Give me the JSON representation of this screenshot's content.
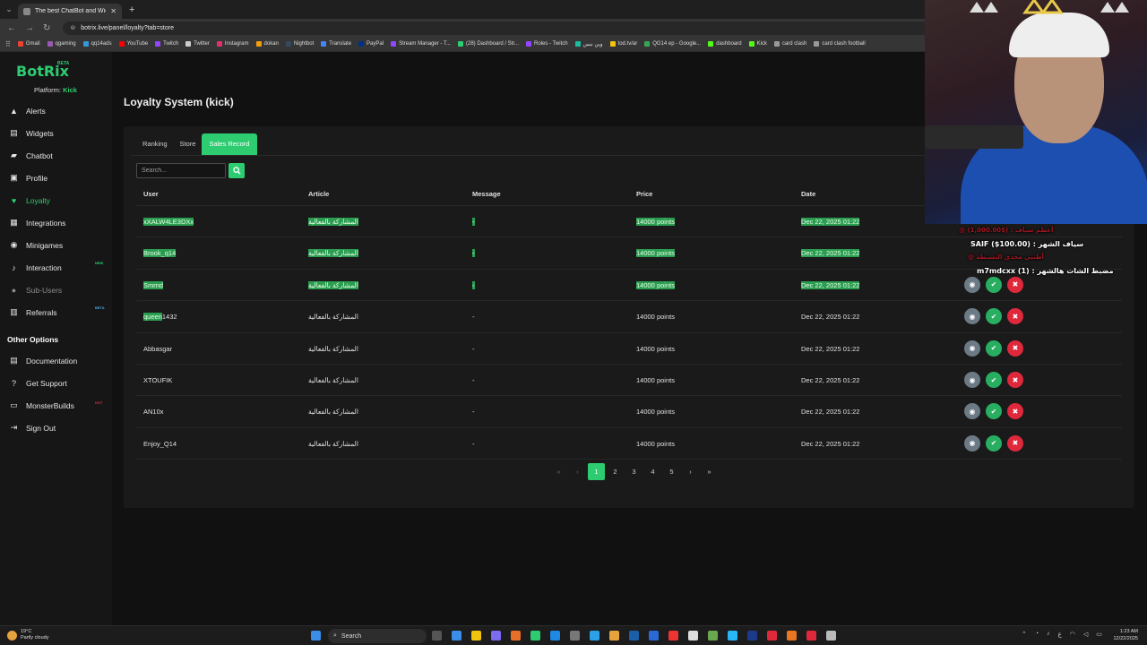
{
  "browser": {
    "tab_title": "The best ChatBot and Widgets",
    "url": "botrix.live/panel/loyalty?tab=store",
    "bookmarks": [
      {
        "label": "Gmail",
        "color": "#ea4335"
      },
      {
        "label": "qgaming",
        "color": "#9b59b6"
      },
      {
        "label": "qq14ads",
        "color": "#3498db"
      },
      {
        "label": "YouTube",
        "color": "#ff0000"
      },
      {
        "label": "Twitch",
        "color": "#9146ff"
      },
      {
        "label": "Twitter",
        "color": "#cccccc"
      },
      {
        "label": "Instagram",
        "color": "#e1306c"
      },
      {
        "label": "dokan",
        "color": "#f39c12"
      },
      {
        "label": "Nightbot",
        "color": "#34495e"
      },
      {
        "label": "Translate",
        "color": "#4285f4"
      },
      {
        "label": "PayPal",
        "color": "#003087"
      },
      {
        "label": "Stream Manager - T...",
        "color": "#9146ff"
      },
      {
        "label": "(28) Dashboard / Str...",
        "color": "#2ecc71"
      },
      {
        "label": "Roles - Twitch",
        "color": "#9146ff"
      },
      {
        "label": "وين نبس",
        "color": "#1abc9c"
      },
      {
        "label": "tod.tv/ar",
        "color": "#f1c40f"
      },
      {
        "label": "QG14 ep - Google...",
        "color": "#34a853"
      },
      {
        "label": "dashboard",
        "color": "#53fc18"
      },
      {
        "label": "Kick",
        "color": "#53fc18"
      },
      {
        "label": "card clash",
        "color": "#999999"
      },
      {
        "label": "card clash football",
        "color": "#999999"
      }
    ]
  },
  "sidebar": {
    "logo": "BotRix",
    "logo_badge": "BETA",
    "platform_label": "Platform:",
    "platform_value": "Kick",
    "items": [
      {
        "label": "Alerts",
        "icon": "▲",
        "state": ""
      },
      {
        "label": "Widgets",
        "icon": "▤",
        "state": ""
      },
      {
        "label": "Chatbot",
        "icon": "▰",
        "state": ""
      },
      {
        "label": "Profile",
        "icon": "▣",
        "state": ""
      },
      {
        "label": "Loyalty",
        "icon": "♥",
        "state": "active"
      },
      {
        "label": "Integrations",
        "icon": "▦",
        "state": ""
      },
      {
        "label": "Minigames",
        "icon": "◉",
        "state": ""
      },
      {
        "label": "Interaction",
        "icon": "♪",
        "state": ""
      },
      {
        "label": "Sub-Users",
        "icon": "●",
        "state": "disabled"
      },
      {
        "label": "Referrals",
        "icon": "▥",
        "state": ""
      }
    ],
    "interaction_tag": "NEW",
    "referrals_tag": "BETA",
    "other_options_title": "Other Options",
    "other_items": [
      {
        "label": "Documentation",
        "icon": "▤"
      },
      {
        "label": "Get Support",
        "icon": "?"
      },
      {
        "label": "MonsterBuilds",
        "icon": "▭"
      },
      {
        "label": "Sign Out",
        "icon": "⇥"
      }
    ],
    "monsterbuilds_tag": "HOT"
  },
  "main": {
    "title": "Loyalty System (kick)",
    "tabs": [
      "Ranking",
      "Store",
      "Sales Record"
    ],
    "active_tab": "Sales Record",
    "search_placeholder": "Search...",
    "columns": [
      "User",
      "Article",
      "Message",
      "Price",
      "Date"
    ],
    "rows": [
      {
        "user": "xXALW4LE3DXx",
        "article": "المشاركة بالفعالية",
        "message": "-",
        "price": "14000 points",
        "date": "Dec 22, 2025 01:22",
        "highlight": "full",
        "actions": false
      },
      {
        "user": "Brook_q14",
        "article": "المشاركة بالفعالية",
        "message": "-",
        "price": "14000 points",
        "date": "Dec 22, 2025 01:22",
        "highlight": "full",
        "actions": false
      },
      {
        "user": "Smrnd",
        "article": "المشاركة بالفعالية",
        "message": "-",
        "price": "14000 points",
        "date": "Dec 22, 2025 01:22",
        "highlight": "full",
        "actions": true
      },
      {
        "user": "queen1432",
        "article": "المشاركة بالفعالية",
        "message": "-",
        "price": "14000 points",
        "date": "Dec 22, 2025 01:22",
        "highlight": "partial",
        "actions": true
      },
      {
        "user": "Abbasgar",
        "article": "المشاركة بالفعالية",
        "message": "-",
        "price": "14000 points",
        "date": "Dec 22, 2025 01:22",
        "highlight": "none",
        "actions": true
      },
      {
        "user": "XTOUFIK",
        "article": "المشاركة بالفعالية",
        "message": "-",
        "price": "14000 points",
        "date": "Dec 22, 2025 01:22",
        "highlight": "none",
        "actions": true
      },
      {
        "user": "AN10x",
        "article": "المشاركة بالفعالية",
        "message": "-",
        "price": "14000 points",
        "date": "Dec 22, 2025 01:22",
        "highlight": "none",
        "actions": true
      },
      {
        "user": "Enjoy_Q14",
        "article": "المشاركة بالفعالية",
        "message": "-",
        "price": "14000 points",
        "date": "Dec 22, 2025 01:22",
        "highlight": "none",
        "actions": true
      }
    ],
    "pagination": {
      "first": "«",
      "prev": "‹",
      "pages": [
        "1",
        "2",
        "3",
        "4",
        "5"
      ],
      "current": "1",
      "next": "›",
      "last": "»"
    }
  },
  "stream_overlay": {
    "line1_red": "@ أعظم سياف : ($1,000.00)",
    "line2": "SAIF ($100.00) : سياف الشهر",
    "line3_red": "@ أطنبي محدي النشيطة",
    "line4": "m7mdcxx (1) : مضبط الشات هالشهر"
  },
  "taskbar": {
    "weather_temp": "19°C",
    "weather_desc": "Partly cloudy",
    "search_label": "Search",
    "time": "1:23 AM",
    "date": "12/22/2025",
    "lang": "ع"
  },
  "colors": {
    "accent": "#2ecc71",
    "danger": "#e0283c",
    "view": "#6c7a86"
  }
}
